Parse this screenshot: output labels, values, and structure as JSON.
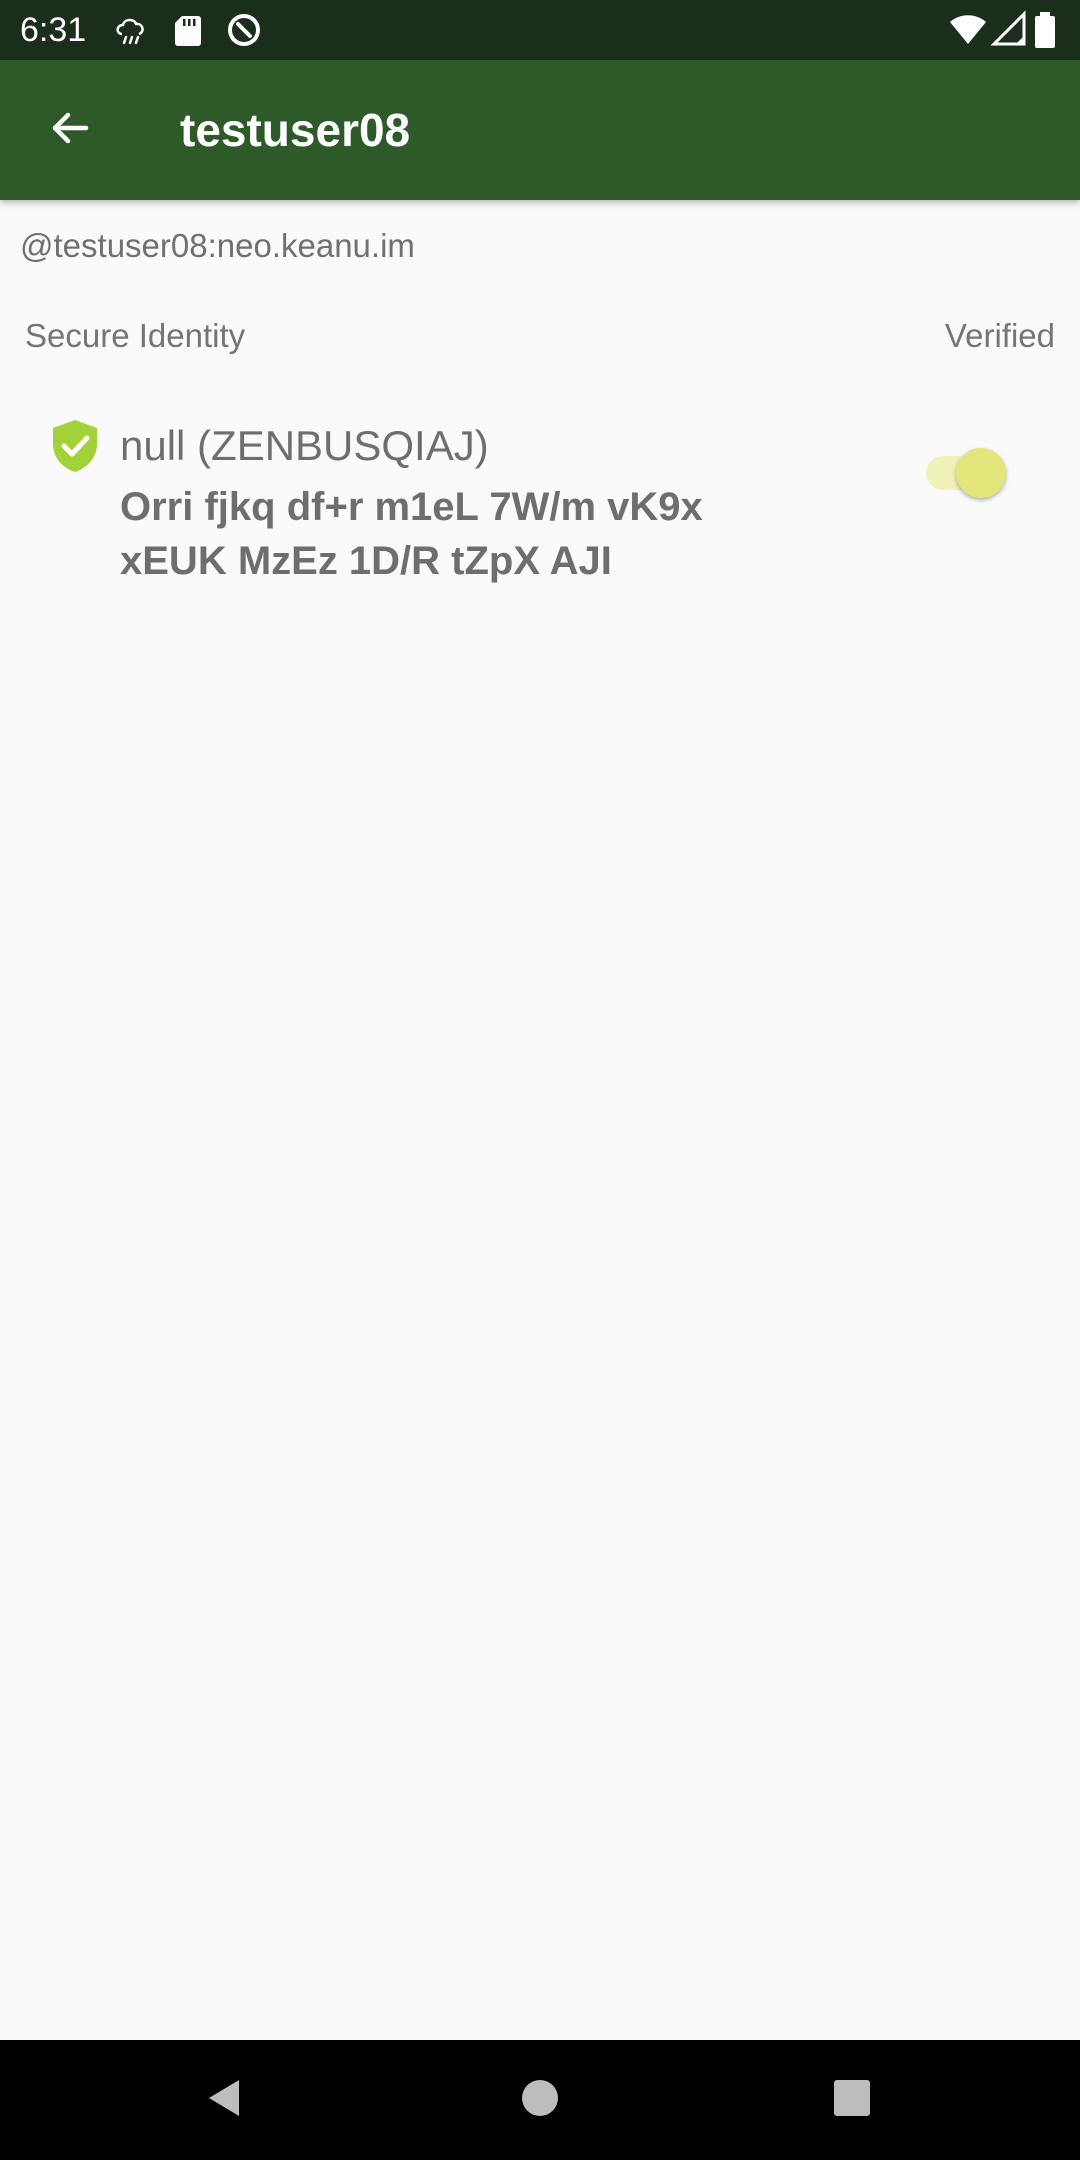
{
  "status_bar": {
    "time": "6:31",
    "icons_left": [
      "cloud-download-icon",
      "sd-card-icon",
      "vpn-icon"
    ],
    "icons_right": [
      "wifi-icon",
      "signal-icon",
      "battery-icon"
    ]
  },
  "app_bar": {
    "title": "testuser08",
    "back_icon": "arrow-back-icon",
    "background_color": "#2e5a2a"
  },
  "content": {
    "matrix_id": "@testuser08:neo.keanu.im",
    "section_label": "Secure Identity",
    "verified_label": "Verified",
    "identity": {
      "name": "null (ZENBUSQIAJ)",
      "fingerprint_line1": "Orri fjkq df+r m1eL 7W/m vK9x",
      "fingerprint_line2": "xEUK MzEz 1D/R tZpX AJI",
      "shield_icon": "verified-shield-icon",
      "shield_color": "#a4d13a",
      "verified_toggle_on": true,
      "toggle_color": "#e3e67a"
    }
  },
  "nav_bar": {
    "buttons": [
      "back-triangle-icon",
      "home-circle-icon",
      "recents-square-icon"
    ]
  }
}
